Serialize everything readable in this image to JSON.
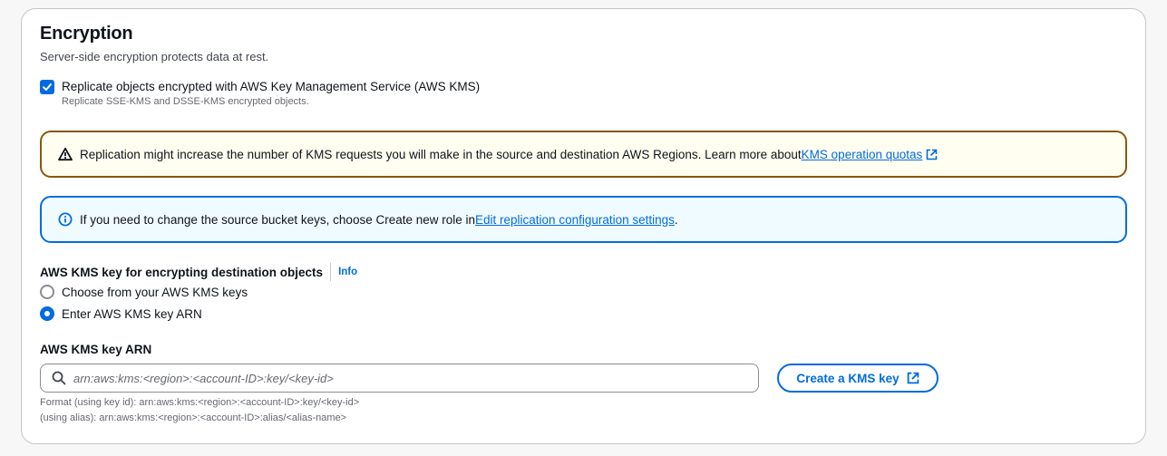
{
  "section": {
    "title": "Encryption",
    "subtitle": "Server-side encryption protects data at rest."
  },
  "replicate_kms": {
    "checked": true,
    "label": "Replicate objects encrypted with AWS Key Management Service (AWS KMS)",
    "description": "Replicate SSE-KMS and DSSE-KMS encrypted objects."
  },
  "warning_alert": {
    "text": "Replication might increase the number of KMS requests you will make in the source and destination AWS Regions. Learn more about ",
    "link": "KMS operation quotas"
  },
  "info_alert": {
    "text": "If you need to change the source bucket keys, choose Create new role in ",
    "link": "Edit replication configuration settings",
    "suffix": "."
  },
  "kms_key": {
    "label": "AWS KMS key for encrypting destination objects",
    "info": "Info",
    "options": [
      {
        "label": "Choose from your AWS KMS keys",
        "selected": false
      },
      {
        "label": "Enter AWS KMS key ARN",
        "selected": true
      }
    ]
  },
  "arn": {
    "label": "AWS KMS key ARN",
    "value": "",
    "placeholder": "arn:aws:kms:<region>:<account-ID>:key/<key-id>",
    "create_button": "Create a KMS key",
    "hint_line1": "Format (using key id): arn:aws:kms:<region>:<account-ID>:key/<key-id>",
    "hint_line2": "(using alias): arn:aws:kms:<region>:<account-ID>:alias/<alias-name>"
  },
  "colors": {
    "accent": "#006ce0",
    "warning_border": "#855900",
    "warning_bg": "#fffef0",
    "info_bg": "#f0fbff"
  }
}
